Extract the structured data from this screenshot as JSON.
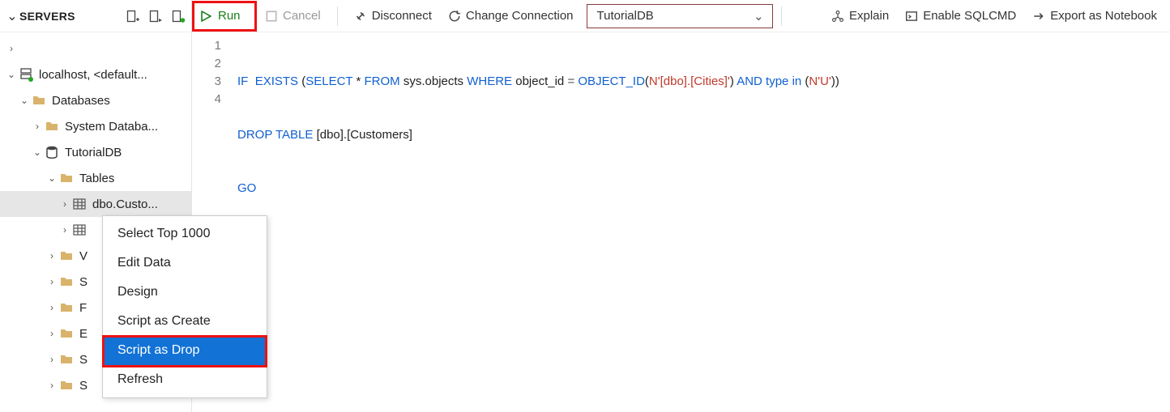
{
  "panel": {
    "title": "SERVERS"
  },
  "tree": {
    "server": "localhost, <default...",
    "databases": "Databases",
    "sysdb": "System Databa...",
    "tutdb": "TutorialDB",
    "tables": "Tables",
    "custo": "dbo.Custo...",
    "f1": "V",
    "f2": "S",
    "f3": "F",
    "f4": "E",
    "f5": "S",
    "f6": "S"
  },
  "context_menu": {
    "select_top": "Select Top 1000",
    "edit_data": "Edit Data",
    "design": "Design",
    "script_create": "Script as Create",
    "script_drop": "Script as Drop",
    "refresh": "Refresh"
  },
  "toolbar": {
    "run": "Run",
    "cancel": "Cancel",
    "disconnect": "Disconnect",
    "change_conn": "Change Connection",
    "db_selected": "TutorialDB",
    "explain": "Explain",
    "sqlcmd": "Enable SQLCMD",
    "notebook": "Export as Notebook"
  },
  "code": {
    "lines": [
      "1",
      "2",
      "3",
      "4"
    ],
    "l1_if": "IF",
    "l1_exists": "EXISTS",
    "l1_select": "SELECT",
    "l1_from": "FROM",
    "l1_sysobj": "sys.objects",
    "l1_where": "WHERE",
    "l1_oid": "object_id",
    "l1_eq": "=",
    "l1_fn": "OBJECT_ID",
    "l1_str": "N'[dbo].[Cities]'",
    "l1_and": "AND",
    "l1_type": "type",
    "l1_in": "in",
    "l1_u": "N'U'",
    "l2_drop": "DROP",
    "l2_table": "TABLE",
    "l2_obj": "[dbo].[Customers]",
    "l3_go": "GO"
  }
}
